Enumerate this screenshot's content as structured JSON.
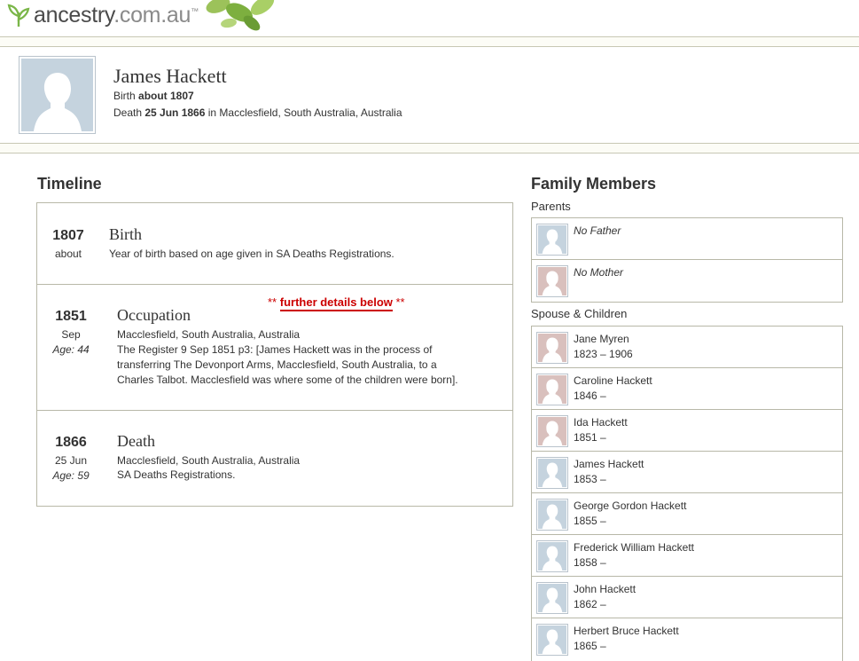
{
  "site": {
    "logo_brand": "ancestry",
    "logo_tld": ".com.au",
    "logo_tm": "™"
  },
  "person": {
    "name": "James Hackett",
    "birth_prefix": "Birth ",
    "birth_value": "about 1807",
    "death_prefix": "Death ",
    "death_date": "25 Jun 1866",
    "death_place": " in Macclesfield, South Australia, Australia"
  },
  "timeline": {
    "title": "Timeline",
    "annotation": {
      "stars_left": "** ",
      "link": "further details below",
      "stars_right": " **"
    },
    "events": [
      {
        "year": "1807",
        "sub": "about",
        "age": "",
        "title": "Birth",
        "lines": [
          "Year of birth based on age given in SA Deaths Registrations."
        ]
      },
      {
        "year": "1851",
        "sub": "Sep",
        "age": "Age: 44",
        "title": "Occupation",
        "lines": [
          "Macclesfield, South Australia, Australia",
          "The Register 9 Sep 1851 p3: [James Hackett was in the process of",
          "transferring The Devonport Arms, Macclesfield, South Australia, to a",
          "Charles Talbot. Macclesfield was where some of the children were born]."
        ]
      },
      {
        "year": "1866",
        "sub": "25 Jun",
        "age": "Age: 59",
        "title": "Death",
        "lines": [
          "Macclesfield, South Australia, Australia",
          "SA Deaths Registrations."
        ]
      }
    ]
  },
  "family": {
    "title": "Family Members",
    "parents_label": "Parents",
    "parents": [
      {
        "name": "No Father",
        "gender": "m"
      },
      {
        "name": "No Mother",
        "gender": "f"
      }
    ],
    "spouse_label": "Spouse & Children",
    "members": [
      {
        "name": "Jane Myren",
        "dates": "1823 – 1906",
        "gender": "f"
      },
      {
        "name": "Caroline Hackett",
        "dates": "1846 –",
        "gender": "f"
      },
      {
        "name": "Ida Hackett",
        "dates": "1851 –",
        "gender": "f"
      },
      {
        "name": "James Hackett",
        "dates": "1853 –",
        "gender": "m"
      },
      {
        "name": "George Gordon Hackett",
        "dates": "1855 –",
        "gender": "m"
      },
      {
        "name": "Frederick William Hackett",
        "dates": "1858 –",
        "gender": "m"
      },
      {
        "name": "John Hackett",
        "dates": "1862 –",
        "gender": "m"
      },
      {
        "name": "Herbert Bruce Hackett",
        "dates": "1865 –",
        "gender": "m"
      }
    ]
  },
  "colors": {
    "accent_red": "#cc0000",
    "male_thumb": "#c5d3de",
    "female_thumb": "#d9c0bd",
    "logo_green": "#7ab648"
  }
}
